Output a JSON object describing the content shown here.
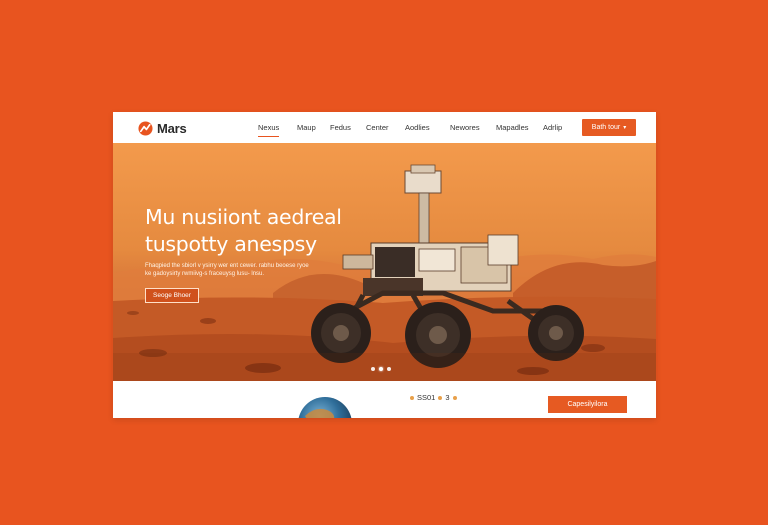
{
  "header": {
    "logo_text": "Mars",
    "nav": [
      "Nexus",
      "Maup",
      "Fedus",
      "Center",
      "Aodlies",
      "Newores",
      "Mapadles",
      "Adrlip"
    ],
    "active_nav": 0,
    "cta_label": "Bath tour",
    "cta_icon": "chevron-down-icon"
  },
  "hero": {
    "title_line1": "Mu nusiiont aedreal",
    "title_line2": "tuspotty anespsy",
    "subtitle": "Fhaqpied the sbiorl v ysirry wer ent cewer. rabhu beoese ryoe ke gadoysirty rwmiivg-s fraceuysg lusu- lnsu.",
    "button_label": "Seoge Bhoer",
    "slides": 3,
    "active_slide": 1
  },
  "strip": {
    "stat_text": "SS01",
    "stat_suffix": "3",
    "cta_label": "Capesilyilora"
  },
  "colors": {
    "background": "#e8541f",
    "accent": "#e65a22",
    "sky_top": "#f39a4c",
    "ground": "#c9622c"
  }
}
